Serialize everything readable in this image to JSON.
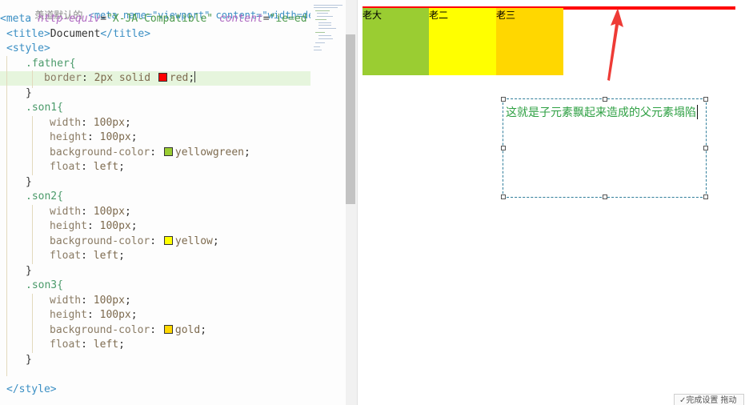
{
  "editor": {
    "partial_top": "羡道默认的",
    "meta_line": {
      "prefix": "<meta ",
      "attr1": "http-equiv",
      "eq1": "=",
      "val1": "\"X-JA-Compatible\"",
      "attr2": " content",
      "eq2": "=",
      "val2": "\"ie=ed"
    },
    "title_line": {
      "open": "<title>",
      "text": "Document",
      "close": "</title>"
    },
    "style_open": "<style>",
    "style_close": "</style>",
    "father": {
      "selector": ".father{",
      "prop": "border",
      "value_pre": "2px solid ",
      "color_name": "red",
      "color_hex": "#ff0000",
      "end": ";"
    },
    "close_brace": "}",
    "son1": {
      "selector": ".son1{",
      "width_prop": "width",
      "width_val": "100px",
      "height_prop": "height",
      "height_val": "100px",
      "bg_prop": "background-color",
      "bg_color_name": "yellowgreen",
      "bg_color_hex": "#9acd32",
      "float_prop": "float",
      "float_val": "left"
    },
    "son2": {
      "selector": ".son2{",
      "width_prop": "width",
      "width_val": "100px",
      "height_prop": "height",
      "height_val": "100px",
      "bg_prop": "background-color",
      "bg_color_name": "yellow",
      "bg_color_hex": "#ffff00",
      "float_prop": "float",
      "float_val": "left"
    },
    "son3": {
      "selector": ".son3{",
      "width_prop": "width",
      "width_val": "100px",
      "height_prop": "height",
      "height_val": "100px",
      "bg_prop": "background-color",
      "bg_color_name": "gold",
      "bg_color_hex": "#ffd700",
      "float_prop": "float",
      "float_val": "left"
    }
  },
  "preview": {
    "son1_label": "老大",
    "son2_label": "老二",
    "son3_label": "老三",
    "border_color": "#ff0000",
    "arrow_color": "#ee3b36",
    "annotation_text": "这就是子元素飘起来造成的父元素塌陷",
    "annotation_color": "#2ea043",
    "bottom_popup": "✓完成设置  拖动"
  }
}
